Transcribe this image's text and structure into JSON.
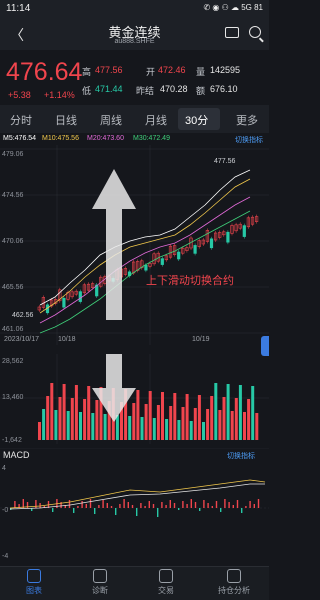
{
  "status_bar": {
    "time": "11:14",
    "icons": "✆ ◉ ⚇ ☁ 5G 81"
  },
  "header": {
    "title": "黄金连续",
    "subtitle": "au888.SHFE"
  },
  "quote": {
    "price": "476.64",
    "change": "+5.38",
    "change_pct": "+1.14%",
    "high_label": "高",
    "high": "477.56",
    "low_label": "低",
    "low": "471.44",
    "open_label": "开",
    "open": "472.46",
    "prev_label": "昨结",
    "prev": "470.28",
    "volume_label": "量",
    "volume": "142595",
    "amount_label": "额",
    "amount": "676.10"
  },
  "tabs": [
    "分时",
    "日线",
    "周线",
    "月线",
    "30分",
    "更多"
  ],
  "active_tab": "30分",
  "ma": {
    "m5": "M5:476.54",
    "m10": "M10:475.56",
    "m20": "M20:473.60",
    "m30": "M30:472.49",
    "switch": "切换指标",
    "colors": {
      "m5": "#ffffff",
      "m10": "#f2c94c",
      "m20": "#e26ad8",
      "m30": "#3fd07a"
    }
  },
  "chart_axis": {
    "y_top": "479.06",
    "y_mid1": "474.56",
    "y_mid2": "470.06",
    "y_mid3": "465.56",
    "y_bottom": "461.06",
    "low_marker": "462.56",
    "high_marker": "477.56"
  },
  "dates": [
    "2023/10/17",
    "10/18",
    "10/19"
  ],
  "hint": "上下滑动切换合约",
  "volume": {
    "top": "28,562",
    "mid": "13,460",
    "bottom": "-1,642",
    "switch": "切换指标"
  },
  "macd": {
    "label": "MACD",
    "switch": "切换指标",
    "y_top": "4",
    "y_mid": "-0",
    "y_bot": "-4"
  },
  "nav": [
    {
      "label": "图表",
      "icon": "chart-icon"
    },
    {
      "label": "诊断",
      "icon": "diagnose-icon"
    },
    {
      "label": "交易",
      "icon": "trade-icon"
    },
    {
      "label": "持仓分析",
      "icon": "position-icon"
    }
  ],
  "colors": {
    "up": "#f0454d",
    "down": "#27c9a6",
    "accent": "#3b7be0"
  }
}
